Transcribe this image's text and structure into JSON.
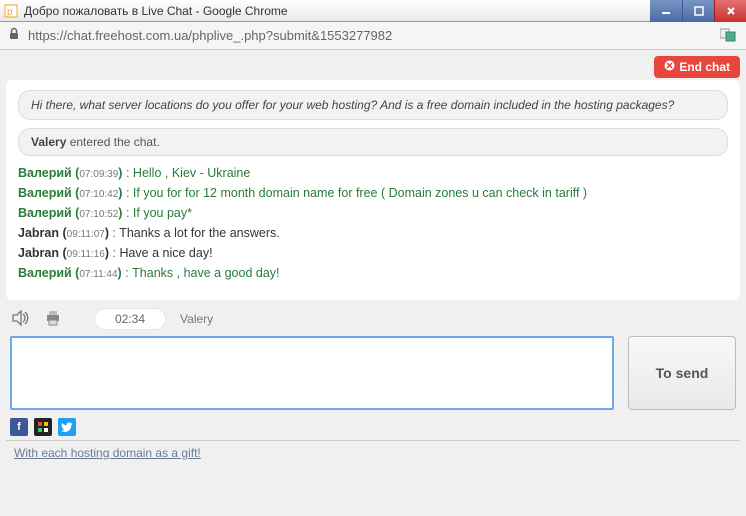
{
  "window": {
    "title": "Добро пожаловать в Live Chat - Google Chrome"
  },
  "addressbar": {
    "url": "https://chat.freehost.com.ua/phplive_.php?submit&1553277982"
  },
  "endchat_label": "End chat",
  "intro_bubble": "Hi there, what server locations do you offer for your web hosting? And is a free domain included in the hosting packages?",
  "system_msg": {
    "who": "Valery",
    "text": " entered the chat."
  },
  "messages": [
    {
      "role": "agent",
      "who": "Валерий",
      "time": "07:09:39",
      "msg": "Hello , Kiev - Ukraine"
    },
    {
      "role": "agent",
      "who": "Валерий",
      "time": "07:10:42",
      "msg": "If you for for 12 month domain name for free ( Domain zones u can check in tariff )"
    },
    {
      "role": "agent",
      "who": "Валерий",
      "time": "07:10:52",
      "msg": "If you pay*"
    },
    {
      "role": "user",
      "who": "Jabran",
      "time": "09:11:07",
      "msg": "Thanks a lot for the answers."
    },
    {
      "role": "user",
      "who": "Jabran",
      "time": "09:11:16",
      "msg": "Have a nice day!"
    },
    {
      "role": "agent",
      "who": "Валерий",
      "time": "07:11:44",
      "msg": "Thanks , have a good day!"
    }
  ],
  "toolbar": {
    "timer": "02:34",
    "operator": "Valery"
  },
  "input_placeholder": "",
  "send_label": "To send",
  "footer_link": "With each hosting domain as a gift!"
}
